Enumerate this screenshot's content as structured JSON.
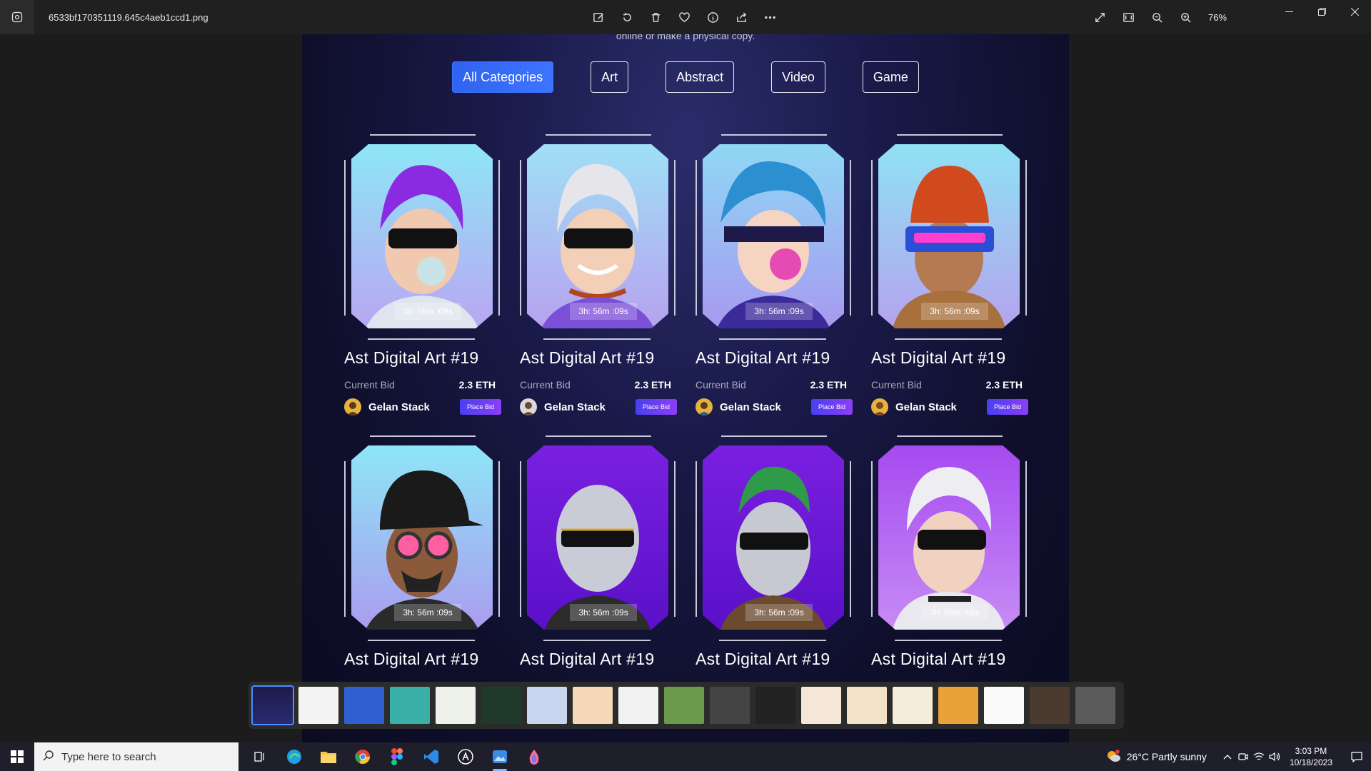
{
  "window": {
    "filename": "6533bf170351119.645c4aeb1ccd1.png",
    "zoom": "76%"
  },
  "webpage": {
    "cut_text": "online or make a physical copy.",
    "categories": [
      {
        "label": "All Categories",
        "active": true
      },
      {
        "label": "Art",
        "active": false
      },
      {
        "label": "Abstract",
        "active": false
      },
      {
        "label": "Video",
        "active": false
      },
      {
        "label": "Game",
        "active": false
      }
    ],
    "cards": [
      {
        "title": "Ast Digital Art #19",
        "timer": "3h: 56m :09s",
        "bid_label": "Current Bid",
        "bid_value": "2.3 ETH",
        "owner": "Gelan Stack",
        "button": "Place Bid"
      },
      {
        "title": "Ast Digital Art #19",
        "timer": "3h: 56m :09s",
        "bid_label": "Current Bid",
        "bid_value": "2.3 ETH",
        "owner": "Gelan Stack",
        "button": "Place Bid"
      },
      {
        "title": "Ast Digital Art #19",
        "timer": "3h: 56m :09s",
        "bid_label": "Current Bid",
        "bid_value": "2.3 ETH",
        "owner": "Gelan Stack",
        "button": "Place Bid"
      },
      {
        "title": "Ast Digital Art #19",
        "timer": "3h: 56m :09s",
        "bid_label": "Current Bid",
        "bid_value": "2.3 ETH",
        "owner": "Gelan Stack",
        "button": "Place Bid"
      },
      {
        "title": "Ast Digital Art #19",
        "timer": "3h: 56m :09s"
      },
      {
        "title": "Ast Digital Art #19",
        "timer": "3h: 56m :09s"
      },
      {
        "title": "Ast Digital Art #19",
        "timer": "3h: 56m :09s"
      },
      {
        "title": "Ast Digital Art #19",
        "timer": "3h: 56m :09s"
      }
    ]
  },
  "taskbar": {
    "search_placeholder": "Type here to search",
    "weather": "26°C  Partly sunny",
    "time": "3:03 PM",
    "date": "10/18/2023"
  },
  "colors": {
    "accent_blue": "#3d74ff",
    "place_bid_start": "#4a3ff0",
    "place_bid_end": "#8b3ff5"
  }
}
